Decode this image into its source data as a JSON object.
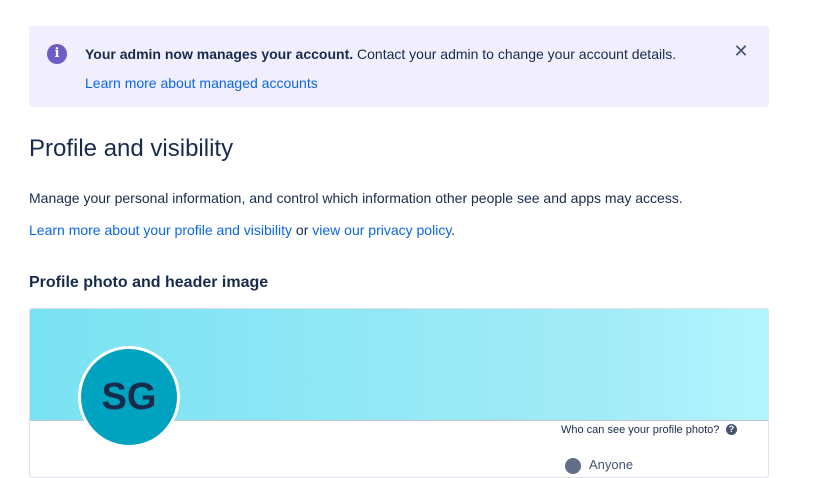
{
  "banner": {
    "icon": "info-icon",
    "title": "Your admin now manages your account.",
    "message": " Contact your admin to change your account details.",
    "link": "Learn more about managed accounts",
    "close_icon": "close-icon",
    "background": "#f1effd",
    "accent": "#6e5dc6"
  },
  "page": {
    "title": "Profile and visibility",
    "description": "Manage your personal information, and control which information other people see and apps may access.",
    "link_profile": "Learn more about your profile and visibility",
    "link_or": " or ",
    "link_privacy": "view our privacy policy",
    "link_period": "."
  },
  "photo_section": {
    "title": "Profile photo and header image",
    "avatar_initials": "SG",
    "avatar_color": "#00a3bf",
    "who_can_see": "Who can see your profile photo?",
    "help_icon": "question-icon",
    "visibility_value": "Anyone",
    "visibility_icon": "globe-icon"
  },
  "colors": {
    "link": "#0c66e4",
    "text": "#172b4d",
    "header_gradient_start": "#79e2f2",
    "header_gradient_end": "#b3f5ff"
  }
}
